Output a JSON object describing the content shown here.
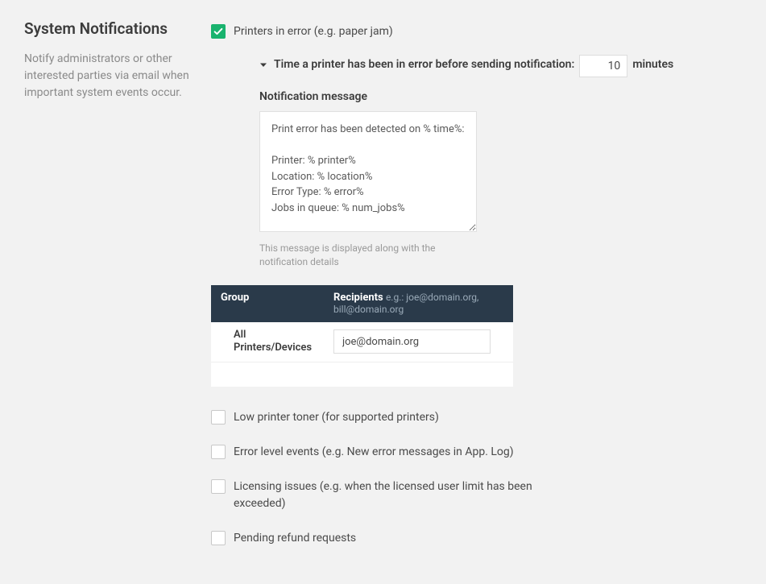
{
  "section": {
    "title": "System Notifications",
    "description": "Notify administrators or other interested parties via email when important system events occur."
  },
  "printers_error": {
    "label": "Printers in error (e.g. paper jam)",
    "time_intro_a": "Time a printer has been in error before sending notification:",
    "time_value": "10",
    "time_unit": "minutes",
    "msg_label": "Notification message",
    "msg_value": "Print error has been detected on % time%:\n\nPrinter: % printer%\nLocation: % location%\nError Type: % error%\nJobs in queue: % num_jobs%",
    "msg_hint": "This message is displayed along with the notification details"
  },
  "table": {
    "header_group": "Group",
    "header_recipients": "Recipients",
    "header_recipients_eg": "e.g.: joe@domain.org, bill@domain.org",
    "row_group": "All Printers/Devices",
    "row_recipients": "joe@domain.org"
  },
  "other_checks": {
    "low_toner": "Low printer toner (for supported printers)",
    "error_events": "Error level events (e.g. New error messages in App. Log)",
    "licensing": "Licensing issues (e.g. when the licensed user limit has been exceeded)",
    "pending_refund": "Pending refund requests"
  }
}
